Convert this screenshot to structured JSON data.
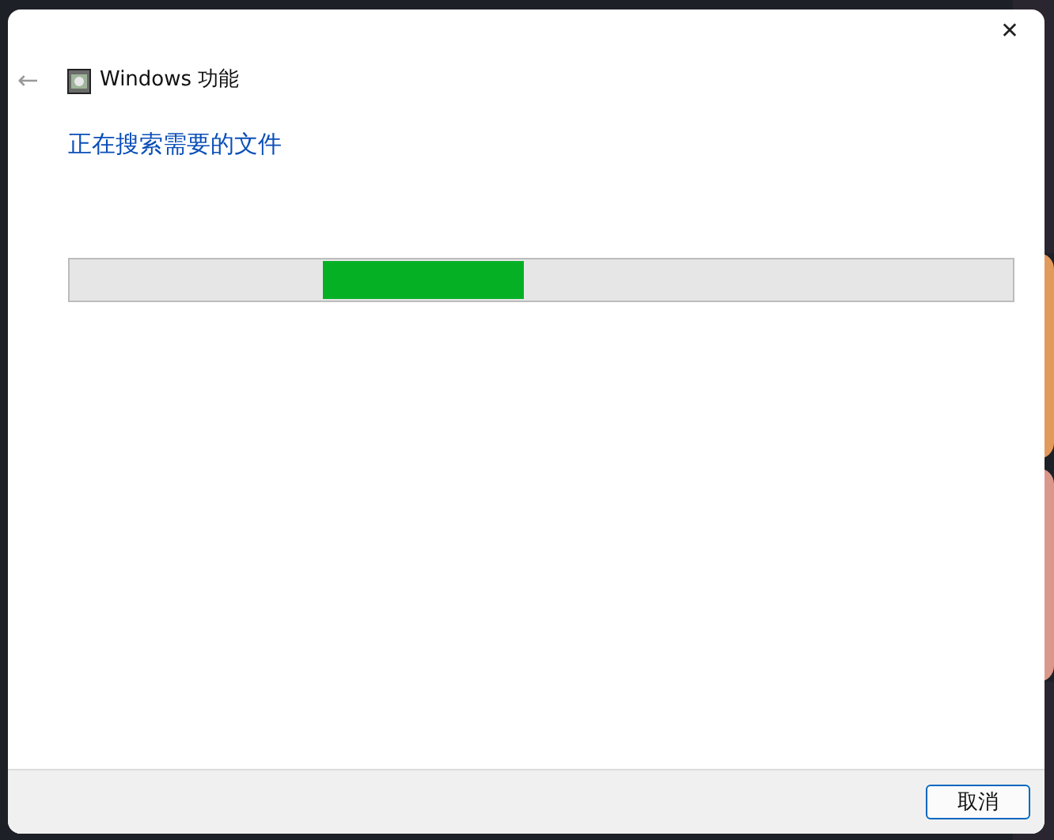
{
  "window": {
    "title": "Windows 功能",
    "close": "✕",
    "back": "←"
  },
  "heading": "正在搜索需要的文件",
  "progress": {
    "kind": "marquee"
  },
  "buttons": [
    "取消"
  ]
}
